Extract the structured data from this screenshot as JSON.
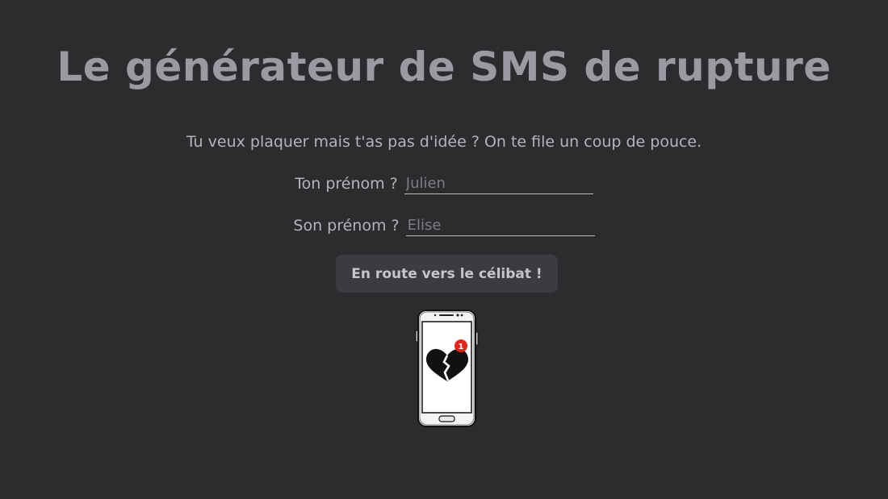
{
  "header": {
    "title": "Le générateur de SMS de rupture"
  },
  "intro": {
    "text": "Tu veux plaquer mais t'as pas d'idée ? On te file un coup de pouce."
  },
  "form": {
    "your_name_label": "Ton prénom ?",
    "your_name_placeholder": "Julien",
    "their_name_label": "Son prénom ?",
    "their_name_placeholder": "Elise",
    "submit_label": "En route vers le célibat !"
  },
  "illustration": {
    "icon": "phone-broken-heart-icon",
    "notification_count": "1",
    "badge_color": "#e8231c"
  },
  "colors": {
    "background": "#2b2c2e",
    "title": "#9a9aa3",
    "text": "#b4b4ba",
    "button_bg": "#3b3c41"
  }
}
